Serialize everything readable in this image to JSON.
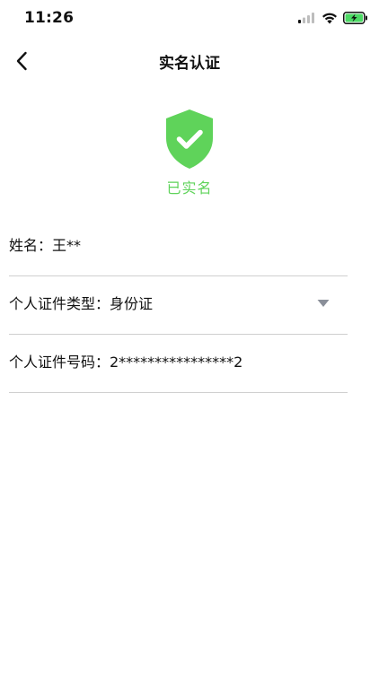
{
  "status_bar": {
    "time": "11:26"
  },
  "nav": {
    "title": "实名认证"
  },
  "badge": {
    "label": "已实名",
    "color": "#5fd35a"
  },
  "form": {
    "name_row": "姓名：王**",
    "id_type_row": "个人证件类型：身份证",
    "id_number_row": "个人证件号码：2****************2"
  },
  "colors": {
    "accent_green": "#5fd35a",
    "divider": "#cfcfcf",
    "arrow_gray": "#8a8f99"
  }
}
